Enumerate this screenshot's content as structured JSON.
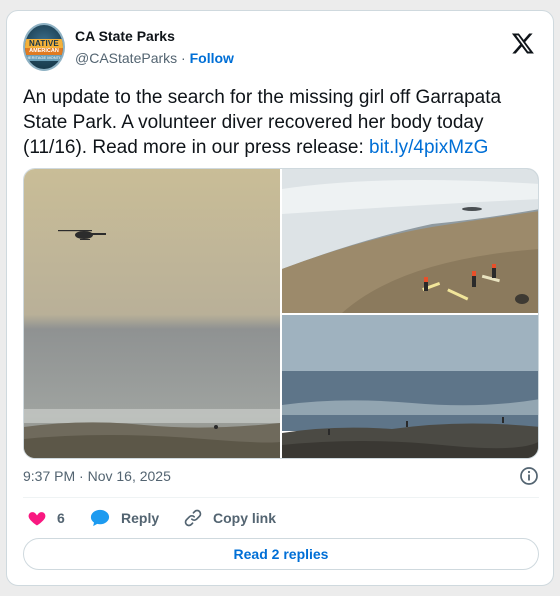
{
  "account": {
    "name": "CA State Parks",
    "handle": "@CAStateParks",
    "separator": "·",
    "follow_label": "Follow",
    "avatar_text": [
      "NATIVE",
      "AMERICAN",
      "HERITAGE MONTH"
    ]
  },
  "tweet": {
    "text": "An update to the search for the missing girl off Garrapata State Park. A volunteer diver recovered her body today (11/16). Read more in our press release:",
    "link": "bit.ly/4pixMzG",
    "timestamp": "9:37 PM · Nov 16, 2025"
  },
  "actions": {
    "like_count": "6",
    "reply_label": "Reply",
    "copy_label": "Copy link"
  },
  "replies_button": "Read 2 replies",
  "icons": {
    "logo": "x-logo-icon",
    "info": "info-icon",
    "like": "heart-icon",
    "reply": "speech-bubble-icon",
    "copy": "link-icon"
  },
  "colors": {
    "link": "#006fd6",
    "like": "#f91880",
    "reply": "#1d9bf0",
    "muted": "#536471"
  }
}
